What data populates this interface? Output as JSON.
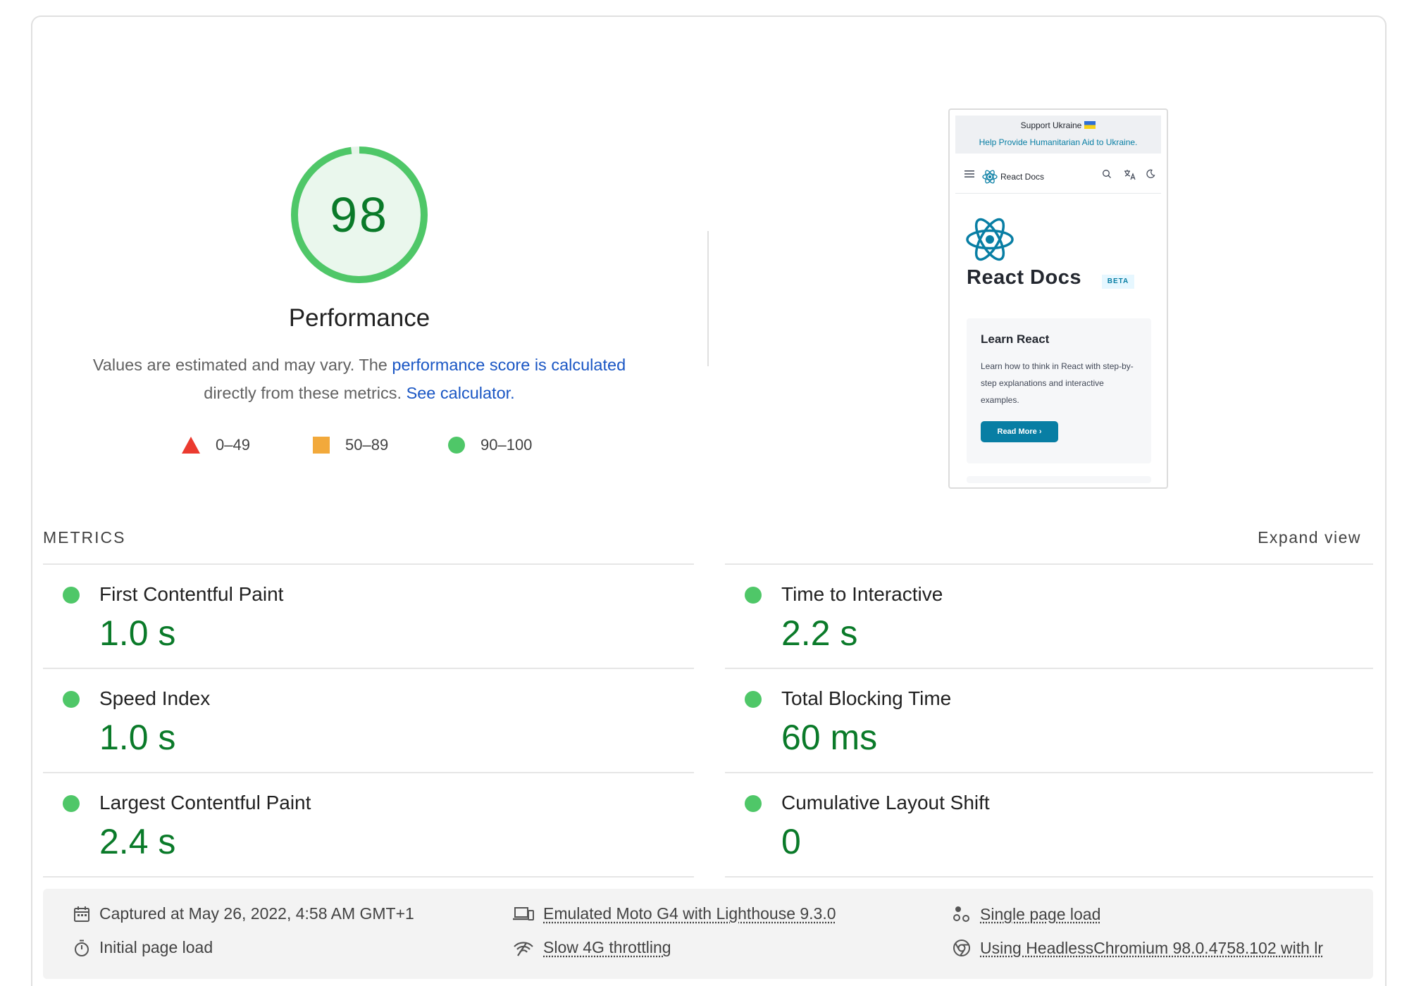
{
  "score": {
    "value": "98",
    "fraction": 0.98,
    "title": "Performance",
    "desc_prefix": "Values are estimated and may vary. The ",
    "desc_link1": "performance score is calculated",
    "desc_mid": "directly from these metrics. ",
    "desc_link2": "See calculator.",
    "colors": {
      "good": "#4fc768",
      "good_text": "#0a7a29",
      "good_fill": "#eaf7ed",
      "average": "#f2a93b",
      "fail": "#eb3a2f"
    }
  },
  "legend": [
    {
      "range": "0–49",
      "icon": "red-triangle"
    },
    {
      "range": "50–89",
      "icon": "orange-square"
    },
    {
      "range": "90–100",
      "icon": "green-circle"
    }
  ],
  "thumbnail": {
    "banner_title": "Support Ukraine",
    "banner_link": "Help Provide Humanitarian Aid to Ukraine.",
    "nav_title": "React Docs",
    "heading": "React Docs",
    "badge": "BETA",
    "card_title": "Learn React",
    "card_text": "Learn how to think in React with step-by-step explanations and interactive examples.",
    "card_button": "Read More"
  },
  "metrics": {
    "header": "METRICS",
    "expand": "Expand view",
    "items": [
      {
        "label": "First Contentful Paint",
        "value": "1.0 s"
      },
      {
        "label": "Time to Interactive",
        "value": "2.2 s"
      },
      {
        "label": "Speed Index",
        "value": "1.0 s"
      },
      {
        "label": "Total Blocking Time",
        "value": "60 ms"
      },
      {
        "label": "Largest Contentful Paint",
        "value": "2.4 s"
      },
      {
        "label": "Cumulative Layout Shift",
        "value": "0"
      }
    ]
  },
  "footer": {
    "captured": "Captured at May 26, 2022, 4:58 AM GMT+1",
    "initial": "Initial page load",
    "device": "Emulated Moto G4 with Lighthouse 9.3.0",
    "throttling": "Slow 4G throttling",
    "single": "Single page load",
    "browser": "Using HeadlessChromium 98.0.4758.102 with lr"
  }
}
